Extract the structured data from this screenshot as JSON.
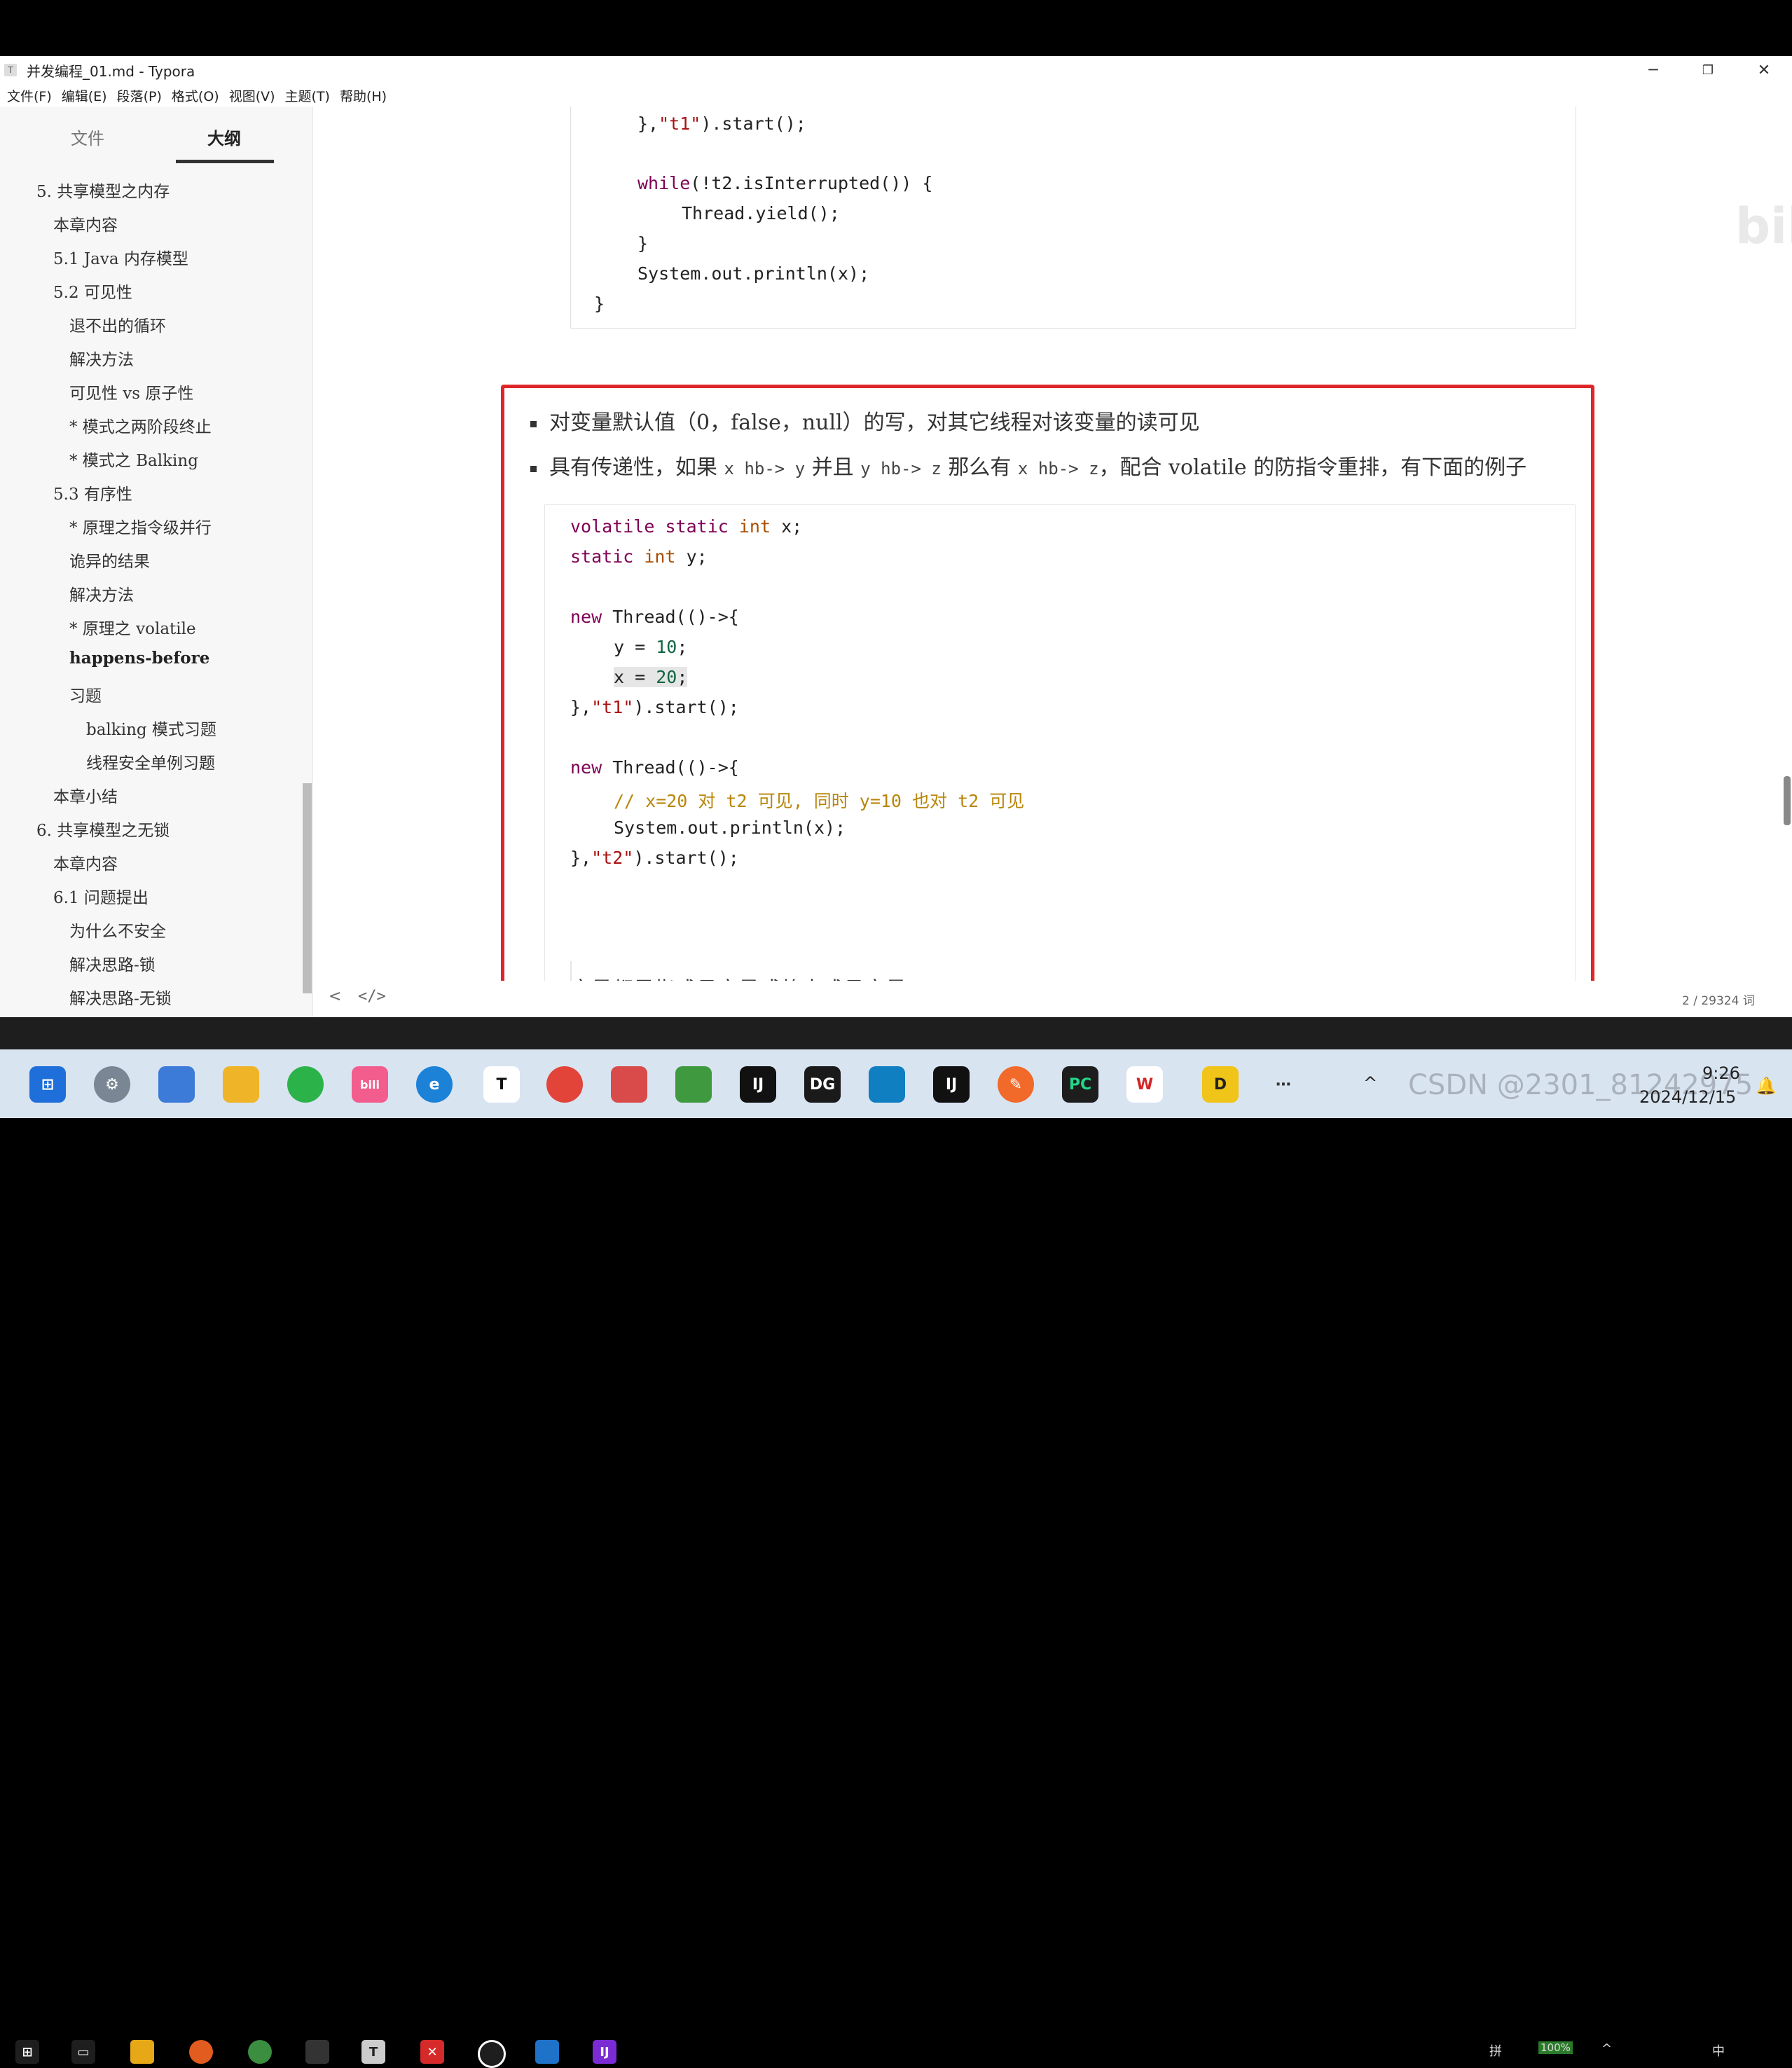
{
  "window": {
    "title": "并发编程_01.md - Typora",
    "app_icon": "T",
    "controls": {
      "minimize": "─",
      "maximize": "❐",
      "close": "✕"
    }
  },
  "menu": [
    "文件(F)",
    "编辑(E)",
    "段落(P)",
    "格式(O)",
    "视图(V)",
    "主题(T)",
    "帮助(H)"
  ],
  "sidebar": {
    "tabs": [
      "文件",
      "大纲"
    ],
    "active_tab": "大纲",
    "outline": [
      {
        "label": "5. 共享模型之内存",
        "level": 1
      },
      {
        "label": "本章内容",
        "level": 2
      },
      {
        "label": "5.1 Java 内存模型",
        "level": 2
      },
      {
        "label": "5.2 可见性",
        "level": 2
      },
      {
        "label": "退不出的循环",
        "level": 3
      },
      {
        "label": "解决方法",
        "level": 3
      },
      {
        "label": "可见性 vs 原子性",
        "level": 3
      },
      {
        "label": "* 模式之两阶段终止",
        "level": 3
      },
      {
        "label": "* 模式之 Balking",
        "level": 3
      },
      {
        "label": "5.3 有序性",
        "level": 2
      },
      {
        "label": "* 原理之指令级并行",
        "level": 3
      },
      {
        "label": "诡异的结果",
        "level": 3
      },
      {
        "label": "解决方法",
        "level": 3
      },
      {
        "label": "* 原理之 volatile",
        "level": 3
      },
      {
        "label": "happens-before",
        "level": 3,
        "bold": true
      },
      {
        "label": "习题",
        "level": 3
      },
      {
        "label": "balking 模式习题",
        "level": 4
      },
      {
        "label": "线程安全单例习题",
        "level": 4
      },
      {
        "label": "本章小结",
        "level": 2
      },
      {
        "label": "6. 共享模型之无锁",
        "level": 1
      },
      {
        "label": "本章内容",
        "level": 2
      },
      {
        "label": "6.1 问题提出",
        "level": 2
      },
      {
        "label": "为什么不安全",
        "level": 3
      },
      {
        "label": "解决思路-锁",
        "level": 3
      },
      {
        "label": "解决思路-无锁",
        "level": 3
      }
    ]
  },
  "editor": {
    "code_top": {
      "l1": [
        "},",
        "\"t1\"",
        ").start();"
      ],
      "l2": [
        "while",
        "(!t2.isInterrupted()) {"
      ],
      "l3": "Thread.yield();",
      "l4": "}",
      "l5": "System.out.println(x);",
      "l6": "}"
    },
    "bullets": {
      "b1": "对变量默认值（0，false，null）的写，对其它线程对该变量的读可见",
      "b2_pre": "具有传递性，如果",
      "b2_c1": "x hb-> y",
      "b2_mid1": "并且",
      "b2_c2": "y hb-> z",
      "b2_mid2": "那么有",
      "b2_c3": "x hb-> z",
      "b2_post": "，配合 volatile 的防指令重排，有下面的例子"
    },
    "code_main": {
      "l1": [
        "volatile",
        " ",
        "static",
        " ",
        "int",
        " x;"
      ],
      "l2": [
        "static",
        " ",
        "int",
        " y;"
      ],
      "l4": [
        "new",
        " Thread(()->{"
      ],
      "l5": [
        "y = ",
        "10",
        ";"
      ],
      "l6": [
        "x = ",
        "20",
        ";"
      ],
      "l7": [
        "},",
        "\"t1\"",
        ").start();"
      ],
      "l9": [
        "new",
        " Thread(()->{"
      ],
      "l10": "// x=20 对 t2 可见, 同时 y=10 也对 t2 可见",
      "l11": "System.out.println(x);",
      "l12": [
        "},",
        "\"t2\"",
        ").start();"
      ]
    },
    "code_language": "java",
    "paragraph": "变量都是指成员变量或静态成员变量",
    "watermark": "bilibili"
  },
  "statusbar": {
    "left_icon": "<",
    "source_icon": "</>",
    "word_count": "2 / 29324 词"
  },
  "taskbar_top": {
    "tray": [
      "拼",
      "100%",
      "^",
      "中"
    ]
  },
  "taskbar": {
    "time": "9:26",
    "date": "2024/12/15",
    "tray_ime": "中",
    "overlay_watermark": "CSDN @2301_81242975"
  },
  "colors": {
    "highlight_box": "#e0262a",
    "keyword": "#7f0055",
    "string": "#a11",
    "comment": "#b8860b"
  }
}
